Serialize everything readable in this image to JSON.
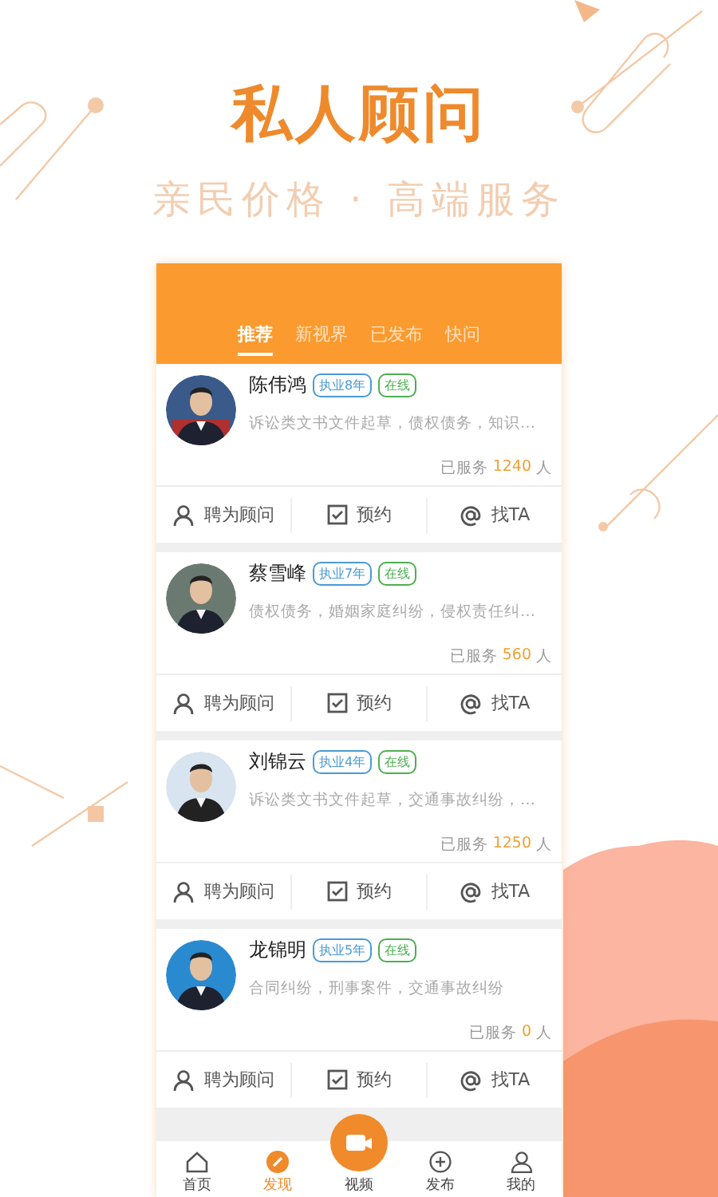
{
  "hero": {
    "title": "私人顾问",
    "subtitle": "亲民价格 · 高端服务"
  },
  "tabs": [
    {
      "label": "推荐",
      "selected": true
    },
    {
      "label": "新视界",
      "selected": false
    },
    {
      "label": "已发布",
      "selected": false
    },
    {
      "label": "快问",
      "selected": false
    }
  ],
  "lawyers": [
    {
      "name": "陈伟鸿",
      "experience": "执业8年",
      "status": "在线",
      "specialties": "诉讼类文书文件起草，债权债务，知识…",
      "served_prefix": "已服务",
      "served_count": "1240",
      "served_suffix": "人",
      "actions": [
        "聘为顾问",
        "预约",
        "找TA"
      ]
    },
    {
      "name": "蔡雪峰",
      "experience": "执业7年",
      "status": "在线",
      "specialties": "债权债务，婚姻家庭纠纷，侵权责任纠…",
      "served_prefix": "已服务",
      "served_count": "560",
      "served_suffix": "人",
      "actions": [
        "聘为顾问",
        "预约",
        "找TA"
      ]
    },
    {
      "name": "刘锦云",
      "experience": "执业4年",
      "status": "在线",
      "specialties": "诉讼类文书文件起草，交通事故纠纷，…",
      "served_prefix": "已服务",
      "served_count": "1250",
      "served_suffix": "人",
      "actions": [
        "聘为顾问",
        "预约",
        "找TA"
      ]
    },
    {
      "name": "龙锦明",
      "experience": "执业5年",
      "status": "在线",
      "specialties": "合同纠纷，刑事案件，交通事故纠纷",
      "served_prefix": "已服务",
      "served_count": "0",
      "served_suffix": "人",
      "actions": [
        "聘为顾问",
        "预约",
        "找TA"
      ]
    }
  ],
  "bottom_nav": [
    {
      "label": "首页",
      "kind": "home",
      "selected": false
    },
    {
      "label": "发现",
      "kind": "discover",
      "selected": true
    },
    {
      "label": "视频",
      "kind": "video",
      "selected": false
    },
    {
      "label": "发布",
      "kind": "publish",
      "selected": false
    },
    {
      "label": "我的",
      "kind": "profile",
      "selected": false
    }
  ]
}
